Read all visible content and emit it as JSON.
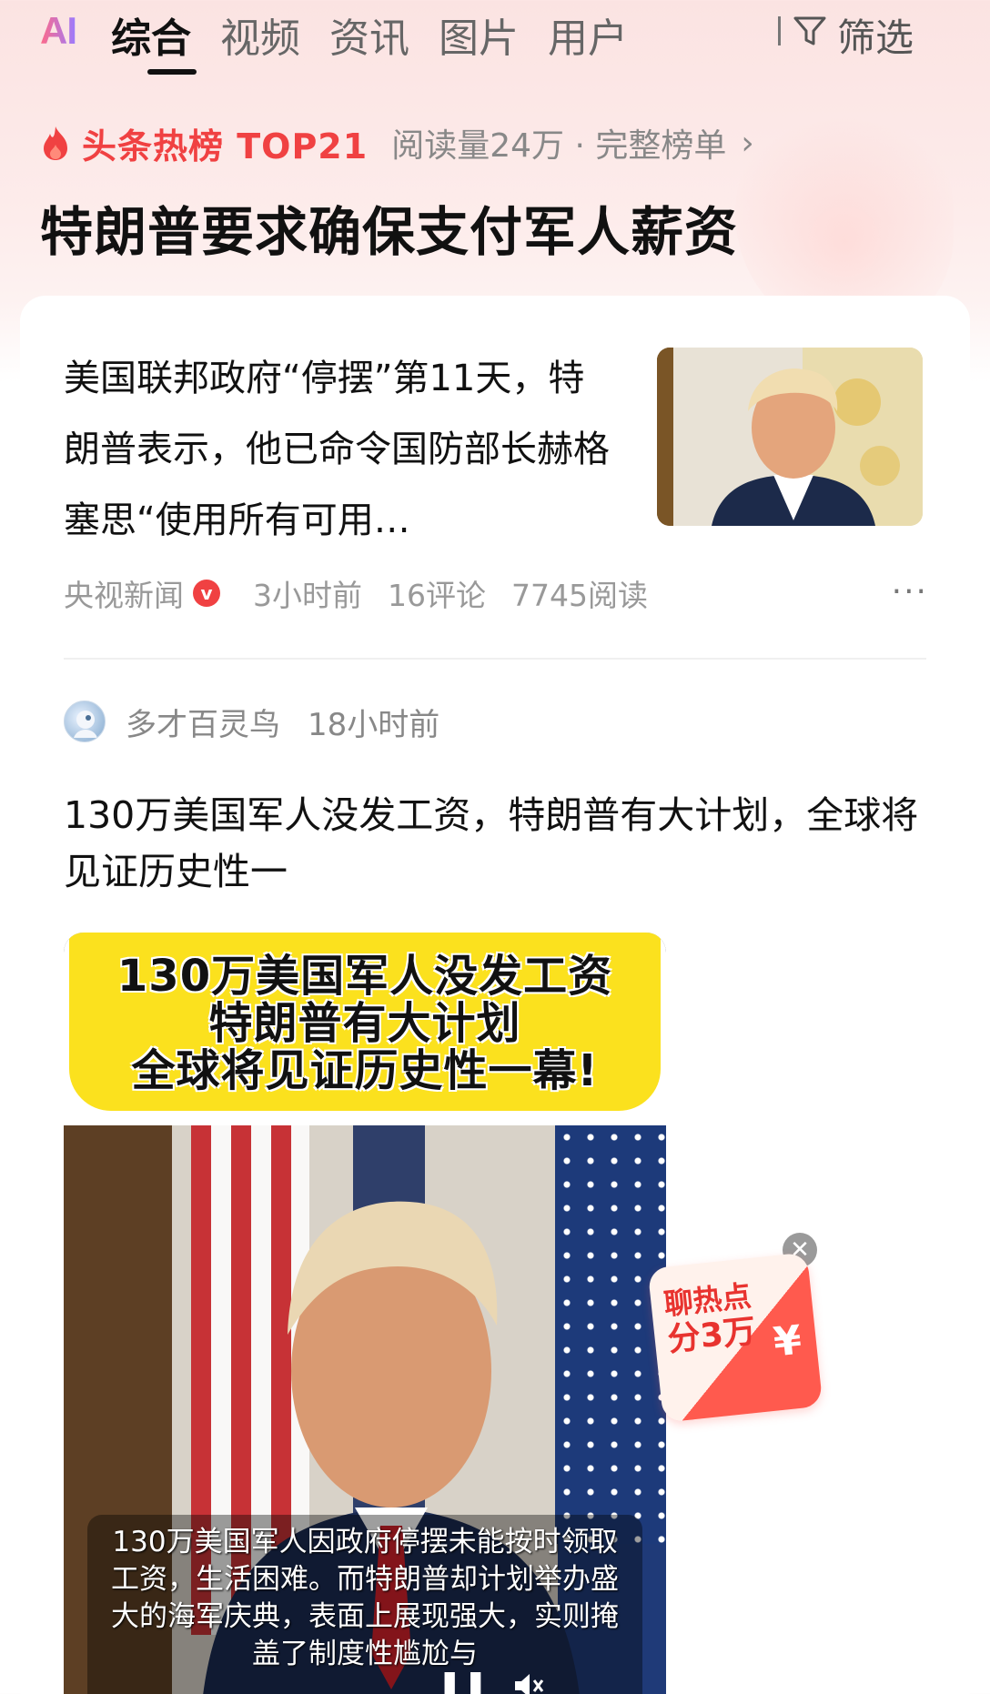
{
  "top_nav": {
    "logo": "AI",
    "tabs": [
      "综合",
      "视频",
      "资讯",
      "图片",
      "用户"
    ],
    "active_tab": "综合",
    "filter_label": "筛选"
  },
  "hot_list": {
    "tag": "头条热榜 TOP21",
    "meta": "阅读量24万 · 完整榜单",
    "headline": "特朗普要求确保支付军人薪资"
  },
  "news_item_1": {
    "summary": "美国联邦政府“停摆”第11天，特朗普表示，他已命令国防部长赫格塞思“使用所有可用…",
    "source": "央视新闻",
    "verified_badge": "v",
    "time": "3小时前",
    "comments": "16评论",
    "reads": "7745阅读",
    "more": "···"
  },
  "news_item_2": {
    "author": "多才百灵鸟",
    "time": "18小时前",
    "title": "130万美国军人没发工资，特朗普有大计划，全球将见证历史性一",
    "video_banner": [
      "130万美国军人没发工资",
      "特朗普有大计划",
      "全球将见证历史性一幕!"
    ],
    "video_caption": "130万美国军人因政府停摆未能按时领取工资，生活困难。而特朗普却计划举办盛大的海军庆典，表面上展现强大，实则掩盖了制度性尴尬与"
  },
  "red_packet": {
    "line1": "聊热点",
    "line2": "分3万",
    "currency": "¥"
  },
  "colors": {
    "accent_red": "#f04142",
    "banner_yellow": "#fbe11e"
  }
}
